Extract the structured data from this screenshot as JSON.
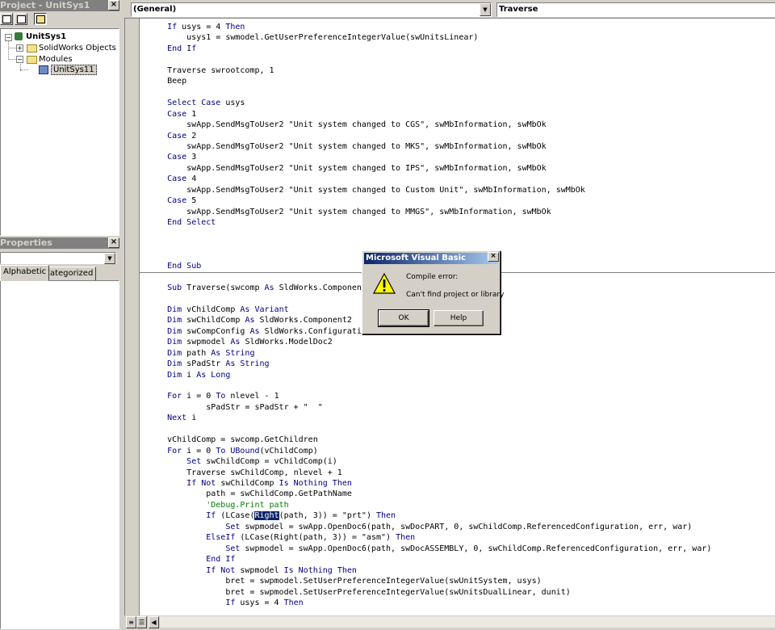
{
  "project_panel": {
    "title": "Project - UnitSys1",
    "close": "×",
    "tree": {
      "project": "UnitSys1",
      "solidworks_objects": "SolidWorks Objects",
      "modules": "Modules",
      "module_item": "UnitSys11"
    }
  },
  "properties_panel": {
    "title": "Properties",
    "close": "×",
    "tabs": [
      "Alphabetic",
      "Categorized"
    ]
  },
  "code_window": {
    "object_combo": "(General)",
    "procedure_combo": "Traverse",
    "lines_top": [
      [
        {
          "t": "    "
        },
        {
          "t": "If",
          "k": 1
        },
        {
          "t": " usys = 4 "
        },
        {
          "t": "Then",
          "k": 1
        }
      ],
      [
        {
          "t": "        usys1 = swmodel.GetUserPreferenceIntegerValue(swUnitsLinear)"
        }
      ],
      [
        {
          "t": "    "
        },
        {
          "t": "End If",
          "k": 1
        }
      ],
      [
        {
          "t": ""
        }
      ],
      [
        {
          "t": "    Traverse swrootcomp, 1"
        }
      ],
      [
        {
          "t": "    Beep"
        }
      ],
      [
        {
          "t": ""
        }
      ],
      [
        {
          "t": "    "
        },
        {
          "t": "Select Case",
          "k": 1
        },
        {
          "t": " usys"
        }
      ],
      [
        {
          "t": "    "
        },
        {
          "t": "Case",
          "k": 1
        },
        {
          "t": " 1"
        }
      ],
      [
        {
          "t": "        swApp.SendMsgToUser2 \"Unit system changed to CGS\", swMbInformation, swMbOk"
        }
      ],
      [
        {
          "t": "    "
        },
        {
          "t": "Case",
          "k": 1
        },
        {
          "t": " 2"
        }
      ],
      [
        {
          "t": "        swApp.SendMsgToUser2 \"Unit system changed to MKS\", swMbInformation, swMbOk"
        }
      ],
      [
        {
          "t": "    "
        },
        {
          "t": "Case",
          "k": 1
        },
        {
          "t": " 3"
        }
      ],
      [
        {
          "t": "        swApp.SendMsgToUser2 \"Unit system changed to IPS\", swMbInformation, swMbOk"
        }
      ],
      [
        {
          "t": "    "
        },
        {
          "t": "Case",
          "k": 1
        },
        {
          "t": " 4"
        }
      ],
      [
        {
          "t": "        swApp.SendMsgToUser2 \"Unit system changed to Custom Unit\", swMbInformation, swMbOk"
        }
      ],
      [
        {
          "t": "    "
        },
        {
          "t": "Case",
          "k": 1
        },
        {
          "t": " 5"
        }
      ],
      [
        {
          "t": "        swApp.SendMsgToUser2 \"Unit system changed to MMGS\", swMbInformation, swMbOk"
        }
      ],
      [
        {
          "t": "    "
        },
        {
          "t": "End Select",
          "k": 1
        }
      ],
      [
        {
          "t": ""
        }
      ],
      [
        {
          "t": ""
        }
      ],
      [
        {
          "t": ""
        }
      ],
      [
        {
          "t": "    "
        },
        {
          "t": "End Sub",
          "k": 1
        }
      ]
    ],
    "lines_bottom": [
      [
        {
          "t": ""
        }
      ],
      [
        {
          "t": "    "
        },
        {
          "t": "Sub",
          "k": 1
        },
        {
          "t": " Traverse(swcomp "
        },
        {
          "t": "As",
          "k": 1
        },
        {
          "t": " SldWorks.Componen"
        }
      ],
      [
        {
          "t": ""
        }
      ],
      [
        {
          "t": "    "
        },
        {
          "t": "Dim",
          "k": 1
        },
        {
          "t": " vChildComp "
        },
        {
          "t": "As Variant",
          "k": 1
        }
      ],
      [
        {
          "t": "    "
        },
        {
          "t": "Dim",
          "k": 1
        },
        {
          "t": " swChildComp "
        },
        {
          "t": "As",
          "k": 1
        },
        {
          "t": " SldWorks.Component2"
        }
      ],
      [
        {
          "t": "    "
        },
        {
          "t": "Dim",
          "k": 1
        },
        {
          "t": " swCompConfig "
        },
        {
          "t": "As",
          "k": 1
        },
        {
          "t": " SldWorks.Configurati"
        }
      ],
      [
        {
          "t": "    "
        },
        {
          "t": "Dim",
          "k": 1
        },
        {
          "t": " swpmodel "
        },
        {
          "t": "As",
          "k": 1
        },
        {
          "t": " SldWorks.ModelDoc2"
        }
      ],
      [
        {
          "t": "    "
        },
        {
          "t": "Dim",
          "k": 1
        },
        {
          "t": " path "
        },
        {
          "t": "As String",
          "k": 1
        }
      ],
      [
        {
          "t": "    "
        },
        {
          "t": "Dim",
          "k": 1
        },
        {
          "t": " sPadStr "
        },
        {
          "t": "As String",
          "k": 1
        }
      ],
      [
        {
          "t": "    "
        },
        {
          "t": "Dim",
          "k": 1
        },
        {
          "t": " i "
        },
        {
          "t": "As Long",
          "k": 1
        }
      ],
      [
        {
          "t": ""
        }
      ],
      [
        {
          "t": "    "
        },
        {
          "t": "For",
          "k": 1
        },
        {
          "t": " i = 0 "
        },
        {
          "t": "To",
          "k": 1
        },
        {
          "t": " nlevel - 1"
        }
      ],
      [
        {
          "t": "            sPadStr = sPadStr + \"  \""
        }
      ],
      [
        {
          "t": "    "
        },
        {
          "t": "Next",
          "k": 1
        },
        {
          "t": " i"
        }
      ],
      [
        {
          "t": ""
        }
      ],
      [
        {
          "t": "    vChildComp = swcomp.GetChildren"
        }
      ],
      [
        {
          "t": "    "
        },
        {
          "t": "For",
          "k": 1
        },
        {
          "t": " i = 0 "
        },
        {
          "t": "To",
          "k": 1
        },
        {
          "t": " "
        },
        {
          "t": "UBound",
          "k": 1
        },
        {
          "t": "(vChildComp)"
        }
      ],
      [
        {
          "t": "        "
        },
        {
          "t": "Set",
          "k": 1
        },
        {
          "t": " swChildComp = vChildComp(i)"
        }
      ],
      [
        {
          "t": "        Traverse swChildComp, nlevel + 1"
        }
      ],
      [
        {
          "t": "        "
        },
        {
          "t": "If Not",
          "k": 1
        },
        {
          "t": " swChildComp "
        },
        {
          "t": "Is Nothing Then",
          "k": 1
        }
      ],
      [
        {
          "t": "            path = swChildComp.GetPathName"
        }
      ],
      [
        {
          "t": "            "
        },
        {
          "t": "'Debug.Print path",
          "c": 1
        }
      ],
      [
        {
          "t": "            "
        },
        {
          "t": "If",
          "k": 1
        },
        {
          "t": " (LCase("
        },
        {
          "t": "Right",
          "h": 1
        },
        {
          "t": "(path, 3)) = \"prt\") "
        },
        {
          "t": "Then",
          "k": 1
        }
      ],
      [
        {
          "t": "                "
        },
        {
          "t": "Set",
          "k": 1
        },
        {
          "t": " swpmodel = swApp.OpenDoc6(path, swDocPART, 0, swChildComp.ReferencedConfiguration, err, war)"
        }
      ],
      [
        {
          "t": "            "
        },
        {
          "t": "ElseIf",
          "k": 1
        },
        {
          "t": " (LCase(Right(path, 3)) = \"asm\") "
        },
        {
          "t": "Then",
          "k": 1
        }
      ],
      [
        {
          "t": "                "
        },
        {
          "t": "Set",
          "k": 1
        },
        {
          "t": " swpmodel = swApp.OpenDoc6(path, swDocASSEMBLY, 0, swChildComp.ReferencedConfiguration, err, war)"
        }
      ],
      [
        {
          "t": "            "
        },
        {
          "t": "End If",
          "k": 1
        }
      ],
      [
        {
          "t": "            "
        },
        {
          "t": "If Not",
          "k": 1
        },
        {
          "t": " swpmodel "
        },
        {
          "t": "Is Nothing Then",
          "k": 1
        }
      ],
      [
        {
          "t": "                bret = swpmodel.SetUserPreferenceIntegerValue(swUnitSystem, usys)"
        }
      ],
      [
        {
          "t": "                bret = swpmodel.SetUserPreferenceIntegerValue(swUnitsDualLinear, dunit)"
        }
      ],
      [
        {
          "t": "                "
        },
        {
          "t": "If",
          "k": 1
        },
        {
          "t": " usys = 4 "
        },
        {
          "t": "Then",
          "k": 1
        }
      ]
    ]
  },
  "dialog": {
    "title": "Microsoft Visual Basic",
    "close": "×",
    "icon": "warning-icon",
    "message_line1": "Compile error:",
    "message_line2": "Can't find project or library",
    "ok": "OK",
    "help": "Help"
  }
}
